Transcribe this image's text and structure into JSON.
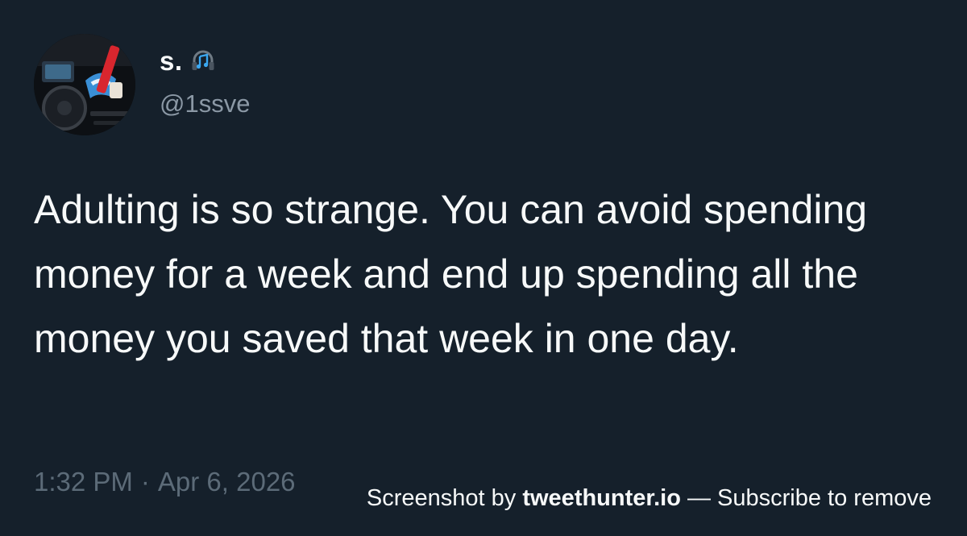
{
  "author": {
    "display_name": "s.",
    "name_icon": "headphones-music-icon",
    "handle": "@1ssve",
    "avatar_icon": "car-interior-avatar"
  },
  "tweet": {
    "text": "Adulting is so strange. You can avoid spending money for a week and end up spending all the money you saved that week in one day.",
    "time": "1:32 PM",
    "separator": "·",
    "date": "Apr 6, 2026"
  },
  "watermark": {
    "prefix": "Screenshot by ",
    "brand": "tweethunter.io",
    "suffix": " — Subscribe to remove"
  },
  "colors": {
    "background": "#15202b",
    "text": "#f7f9f9",
    "muted": "#8b98a5",
    "timestamp": "#5c6b78",
    "accent": "#1d9bf0"
  }
}
